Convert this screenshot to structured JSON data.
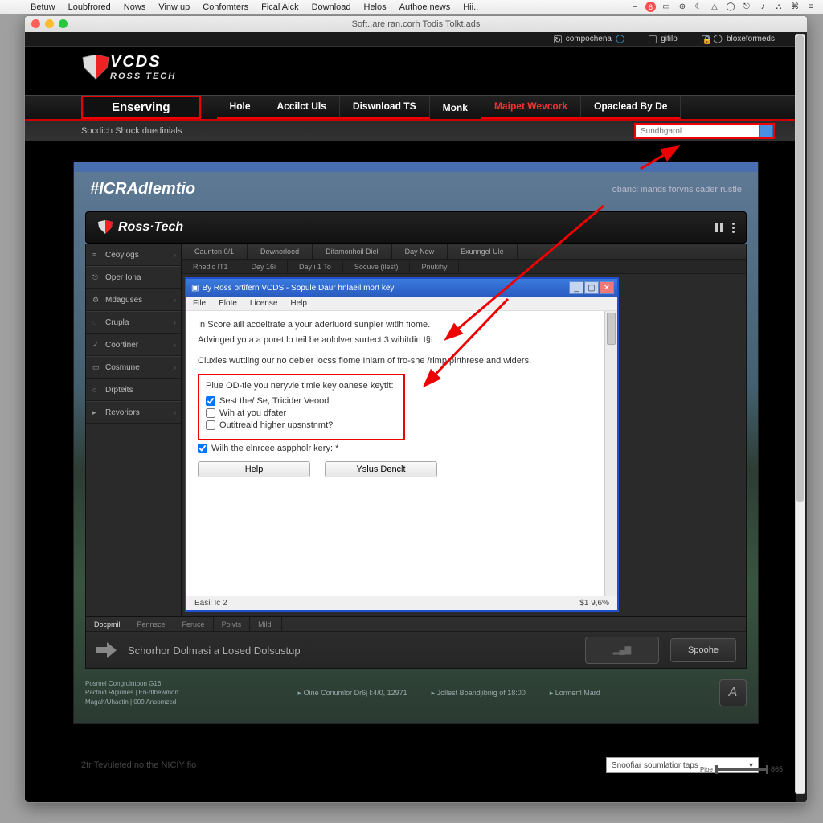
{
  "mac_menu": {
    "items": [
      "Betuw",
      "Loubfrored",
      "Nows",
      "Vinw up",
      "Confomters",
      "Fical Aick",
      "Download",
      "Helos",
      "Authoe news",
      "Hii.."
    ],
    "tray_badge": "6"
  },
  "browser": {
    "title": "Soft..are ran.corh Todis Tolkt.ads"
  },
  "utilbar": {
    "u1": "compochena",
    "u2": "gitilo",
    "u3": "bloxeformeds"
  },
  "logo": {
    "line1": "VCDS",
    "line2": "ROSS TECH"
  },
  "nav": {
    "badge": "Enserving",
    "items": [
      "Hole",
      "Accilct Uls",
      "Diswnload TS",
      "Monk",
      "Maipet Wevcork",
      "Opaclead By De"
    ]
  },
  "crumb": "Socdich Shock duedinials",
  "search": {
    "placeholder": "Sundhgarol"
  },
  "page": {
    "title": "#ICRAdlemtio",
    "subtitle": "obaricl inands forvns cader rustle"
  },
  "rt": {
    "brand": "Ross·Tech"
  },
  "sidenav": [
    {
      "icon": "≡",
      "label": "Ceoylogs",
      "chev": "›"
    },
    {
      "icon": "⎋",
      "label": "Oper Iona"
    },
    {
      "icon": "⚙",
      "label": "Mdaguses",
      "chev": "›"
    },
    {
      "icon": "◌",
      "label": "Crupla",
      "chev": "›"
    },
    {
      "icon": "✓",
      "label": "Coortiner",
      "chev": "›"
    },
    {
      "icon": "▭",
      "label": "Cosmune",
      "chev": "›"
    },
    {
      "icon": "○",
      "label": "Drpteits"
    },
    {
      "icon": "▸",
      "label": "Revoriors",
      "chev": "›"
    }
  ],
  "tabs1": [
    "Caunton 0/1",
    "Dewnorloed",
    "Difamonhoil Diel",
    "Day Now",
    "Exunngel Ule"
  ],
  "tabs2": [
    "Rhedic IT1",
    "Dey 16i",
    "Day i 1 To",
    "Socuve (ilest)",
    "Pnukihy"
  ],
  "dialog": {
    "title": "By Ross ortifern VCDS - Sopule Daur hnlaeil mort key",
    "menus": [
      "File",
      "Elote",
      "License",
      "Help"
    ],
    "p1": "In Score aill acoeltrate a your aderluord sunpler witlh fiome.",
    "p2": "Advinged yo a a poret lo teil be aololver surtect 3 wihitdin I§I",
    "p3": "Cluxles wuttiing our no debler locss fiome Inlarn of fro-she /rimp pirthrese and widers.",
    "q": "Plue OD-tie you neryvle timle key oanese keytit:",
    "cb1": "Sest the/ Se, Tricider Veood",
    "cb2": "Wih at you dfater",
    "cb3": "Outitreald higher upsnstnmt?",
    "cb4": "Wilh the elnrcee asppholr kery: *",
    "btn1": "Help",
    "btn2": "Yslus Denclt",
    "status_l": "Easil Ic 2",
    "status_r": "$1 9,6%"
  },
  "bottabs": [
    "Docpmil",
    "Pennsce",
    "Feruce",
    "Polvts",
    "Mildi"
  ],
  "bottom": {
    "label": "Schorhor Dolmasi a Losed Dolsustup",
    "btn": "Spoohe"
  },
  "footer": {
    "l1": "Posmel Congruintbon G16",
    "l2": "Pactnid Rigirines | En-dthewmort",
    "l3": "Magah/Uhactin | 009 Ansomzed",
    "c1": "Oine Conumlor Dr6j l:4/0, 12971",
    "c2": "Jollest Boandjibnig of 18:00",
    "c3": "Lormerfl Mard"
  },
  "caption": {
    "text": "2tr Tevuleted no the NICIY fio",
    "drop": "Snoofiar soumlatior taps",
    "pg": "865"
  }
}
